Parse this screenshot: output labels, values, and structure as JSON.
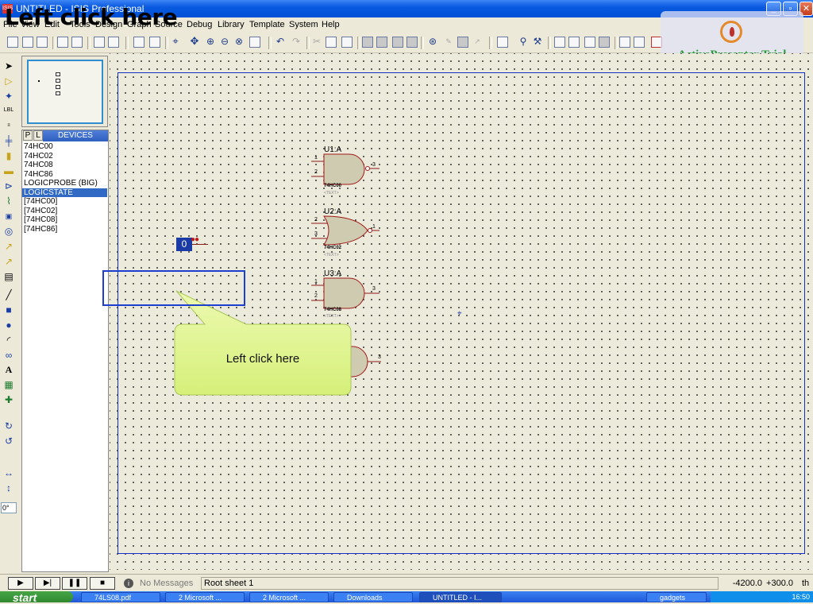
{
  "window": {
    "icon_label": "ISIS",
    "title": "UNTITLED - ISIS Professional",
    "minimize": "_",
    "maximize": "▫",
    "close": "✕"
  },
  "caption": "Left click here",
  "menu": [
    "File",
    "View",
    "Edit",
    "Tools",
    "Design",
    "Graph",
    "Source",
    "Debug",
    "Library",
    "Template",
    "System",
    "Help"
  ],
  "watermark": {
    "text": "ActivePresenter Trial"
  },
  "panel": {
    "tab_p": "P",
    "tab_l": "L",
    "title": "DEVICES",
    "devices": [
      "74HC00",
      "74HC02",
      "74HC08",
      "74HC86",
      "LOGICPROBE (BIG)",
      "LOGICSTATE",
      "[74HC00]",
      "[74HC02]",
      "[74HC08]",
      "[74HC86]"
    ],
    "selected_index": 5
  },
  "angle": "0°",
  "schematic": {
    "gates": [
      {
        "ref": "U1:A",
        "part": "74HC00",
        "text": "<TEXT>",
        "pins": [
          "1",
          "2",
          "3"
        ]
      },
      {
        "ref": "U2:A",
        "part": "74HC02",
        "text": "<TEXT>",
        "pins": [
          "2",
          "3",
          "1"
        ]
      },
      {
        "ref": "U3:A",
        "part": "74HC08",
        "text": "<TEXT>",
        "pins": [
          "1",
          "2",
          "3"
        ]
      },
      {
        "ref": "",
        "part": "",
        "text": "",
        "pins": [
          "3"
        ]
      }
    ],
    "logicstate": {
      "value": "0",
      "pins": "●●"
    }
  },
  "callout": {
    "text": "Left click here"
  },
  "status": {
    "message": "No Messages",
    "sheet": "Root sheet 1",
    "x": "-4200.0",
    "y": "+300.0",
    "unit": "th"
  },
  "taskbar": {
    "start": "start",
    "tasks": [
      "74LS08.pdf",
      "2 Microsoft ...",
      "2 Microsoft ...",
      "Downloads",
      "UNTITLED - I...",
      "gadgets"
    ],
    "active_index": 4,
    "clock": "16:50"
  }
}
